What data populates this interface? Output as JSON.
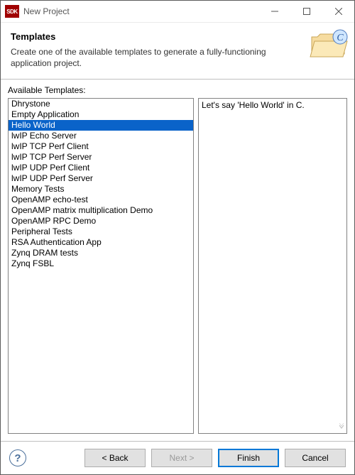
{
  "window": {
    "app_badge": "SDK",
    "title": "New Project"
  },
  "header": {
    "title": "Templates",
    "description": "Create one of the available templates to generate a fully-functioning application project."
  },
  "templates": {
    "section_label": "Available Templates:",
    "selected_index": 2,
    "items": [
      "Dhrystone",
      "Empty Application",
      "Hello World",
      "lwIP Echo Server",
      "lwIP TCP Perf Client",
      "lwIP TCP Perf Server",
      "lwIP UDP Perf Client",
      "lwIP UDP Perf Server",
      "Memory Tests",
      "OpenAMP echo-test",
      "OpenAMP matrix multiplication Demo",
      "OpenAMP RPC Demo",
      "Peripheral Tests",
      "RSA Authentication App",
      "Zynq DRAM tests",
      "Zynq FSBL"
    ],
    "description": "Let's say 'Hello World' in C."
  },
  "buttons": {
    "back": "< Back",
    "next": "Next >",
    "finish": "Finish",
    "cancel": "Cancel",
    "help_tooltip": "Help"
  }
}
